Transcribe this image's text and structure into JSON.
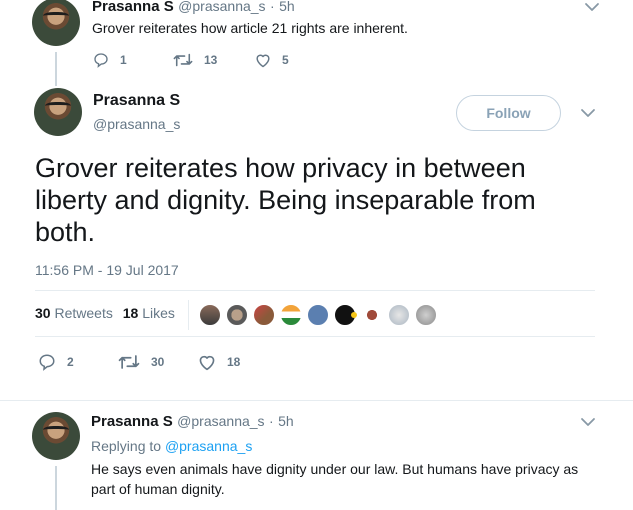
{
  "tweet_prev": {
    "name": "Prasanna S",
    "handle": "@prasanna_s",
    "time": "5h",
    "text": "Grover reiterates how article 21 rights are inherent.",
    "reply_count": "1",
    "retweet_count": "13",
    "like_count": "5"
  },
  "tweet_main": {
    "name": "Prasanna S",
    "handle": "@prasanna_s",
    "follow_label": "Follow",
    "text": "Grover reiterates how privacy in between liberty and dignity.  Being inseparable from both.",
    "timestamp": "11:56 PM - 19 Jul 2017",
    "retweets_count": "30",
    "retweets_label": "Retweets",
    "likes_count": "18",
    "likes_label": "Likes",
    "reply_count": "2",
    "retweet_count": "30",
    "like_count": "18"
  },
  "tweet_next": {
    "name": "Prasanna S",
    "handle": "@prasanna_s",
    "time": "5h",
    "replying_prefix": "Replying to",
    "replying_handle": "@prasanna_s",
    "text": "He says even animals have dignity under our law. But humans have privacy as part of human dignity."
  },
  "colors": {
    "text_primary": "#14171a",
    "text_secondary": "#657786",
    "link_blue": "#1da1f2",
    "divider": "#e6ecf0",
    "follow_border": "#c5d3df"
  },
  "icons": [
    "reply-icon",
    "retweet-icon",
    "like-icon",
    "chevron-down-icon"
  ]
}
